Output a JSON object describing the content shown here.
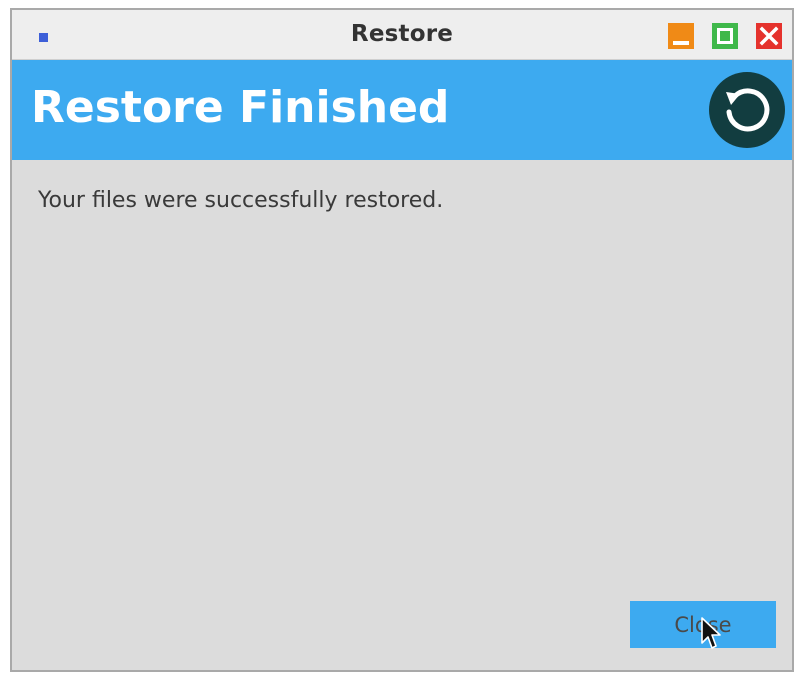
{
  "window": {
    "title": "Restore"
  },
  "titlebar": {
    "app_icon": "app-icon",
    "buttons": {
      "minimize": "minimize-icon",
      "maximize": "maximize-icon",
      "close": "close-icon"
    }
  },
  "header": {
    "title": "Restore Finished",
    "icon": "restore-icon",
    "accent_color": "#3daaf0",
    "icon_bg_color": "#123d40"
  },
  "body": {
    "message": "Your files were successfully restored."
  },
  "footer": {
    "close_label": "Close"
  },
  "cursor": {
    "icon": "mouse-pointer-icon"
  }
}
